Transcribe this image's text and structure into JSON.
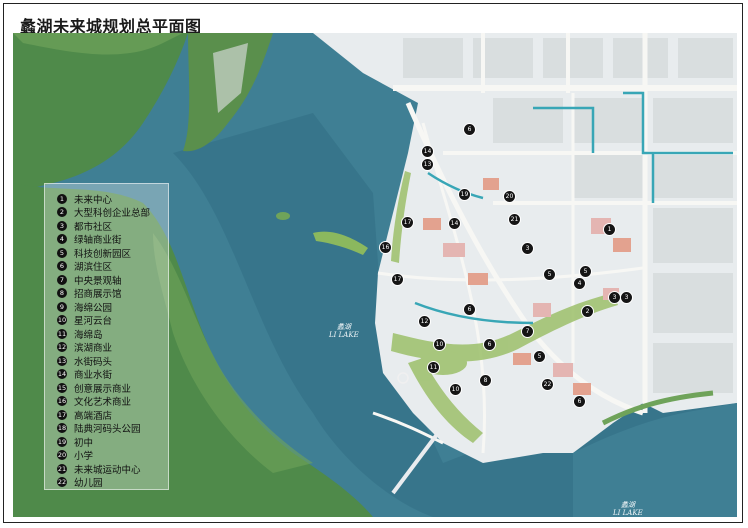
{
  "map": {
    "title": "蠡湖未来城规划总平面图",
    "water_labels": [
      {
        "cn": "蠡湖",
        "en": "LI LAKE"
      },
      {
        "cn": "蠡湖",
        "en": "LI LAKE"
      }
    ],
    "legend": [
      {
        "num": "1",
        "label": "未来中心"
      },
      {
        "num": "2",
        "label": "大型科创企业总部"
      },
      {
        "num": "3",
        "label": "都市社区"
      },
      {
        "num": "4",
        "label": "绿轴商业街"
      },
      {
        "num": "5",
        "label": "科技创新园区"
      },
      {
        "num": "6",
        "label": "湖滨住区"
      },
      {
        "num": "7",
        "label": "中央景观轴"
      },
      {
        "num": "8",
        "label": "招商展示馆"
      },
      {
        "num": "9",
        "label": "海绵公园"
      },
      {
        "num": "10",
        "label": "星河云台"
      },
      {
        "num": "11",
        "label": "海绵岛"
      },
      {
        "num": "12",
        "label": "滨湖商业"
      },
      {
        "num": "13",
        "label": "水街码头"
      },
      {
        "num": "14",
        "label": "商业水街"
      },
      {
        "num": "15",
        "label": "创意展示商业"
      },
      {
        "num": "16",
        "label": "文化艺术商业"
      },
      {
        "num": "17",
        "label": "高端酒店"
      },
      {
        "num": "18",
        "label": "陆典河码头公园"
      },
      {
        "num": "19",
        "label": "初中"
      },
      {
        "num": "20",
        "label": "小学"
      },
      {
        "num": "21",
        "label": "未来城运动中心"
      },
      {
        "num": "22",
        "label": "幼儿园"
      }
    ],
    "markers": [
      "1",
      "2",
      "2",
      "3",
      "3",
      "3",
      "4",
      "5",
      "5",
      "5",
      "6",
      "6",
      "6",
      "6",
      "6",
      "6",
      "7",
      "8",
      "9",
      "10",
      "10",
      "11",
      "11",
      "12",
      "12",
      "13",
      "14",
      "15",
      "16",
      "17",
      "18",
      "19",
      "20",
      "21",
      "22"
    ],
    "colors": {
      "lake": "#3f7f94",
      "lake_dark": "#2f6a80",
      "hill": "#4f8a4a",
      "hill_light": "#6fa35a",
      "urban": "#e8ecee",
      "block": "#d9dedf",
      "road": "#f7f7f4",
      "green": "#9cc06a",
      "frame": "#222222"
    }
  }
}
